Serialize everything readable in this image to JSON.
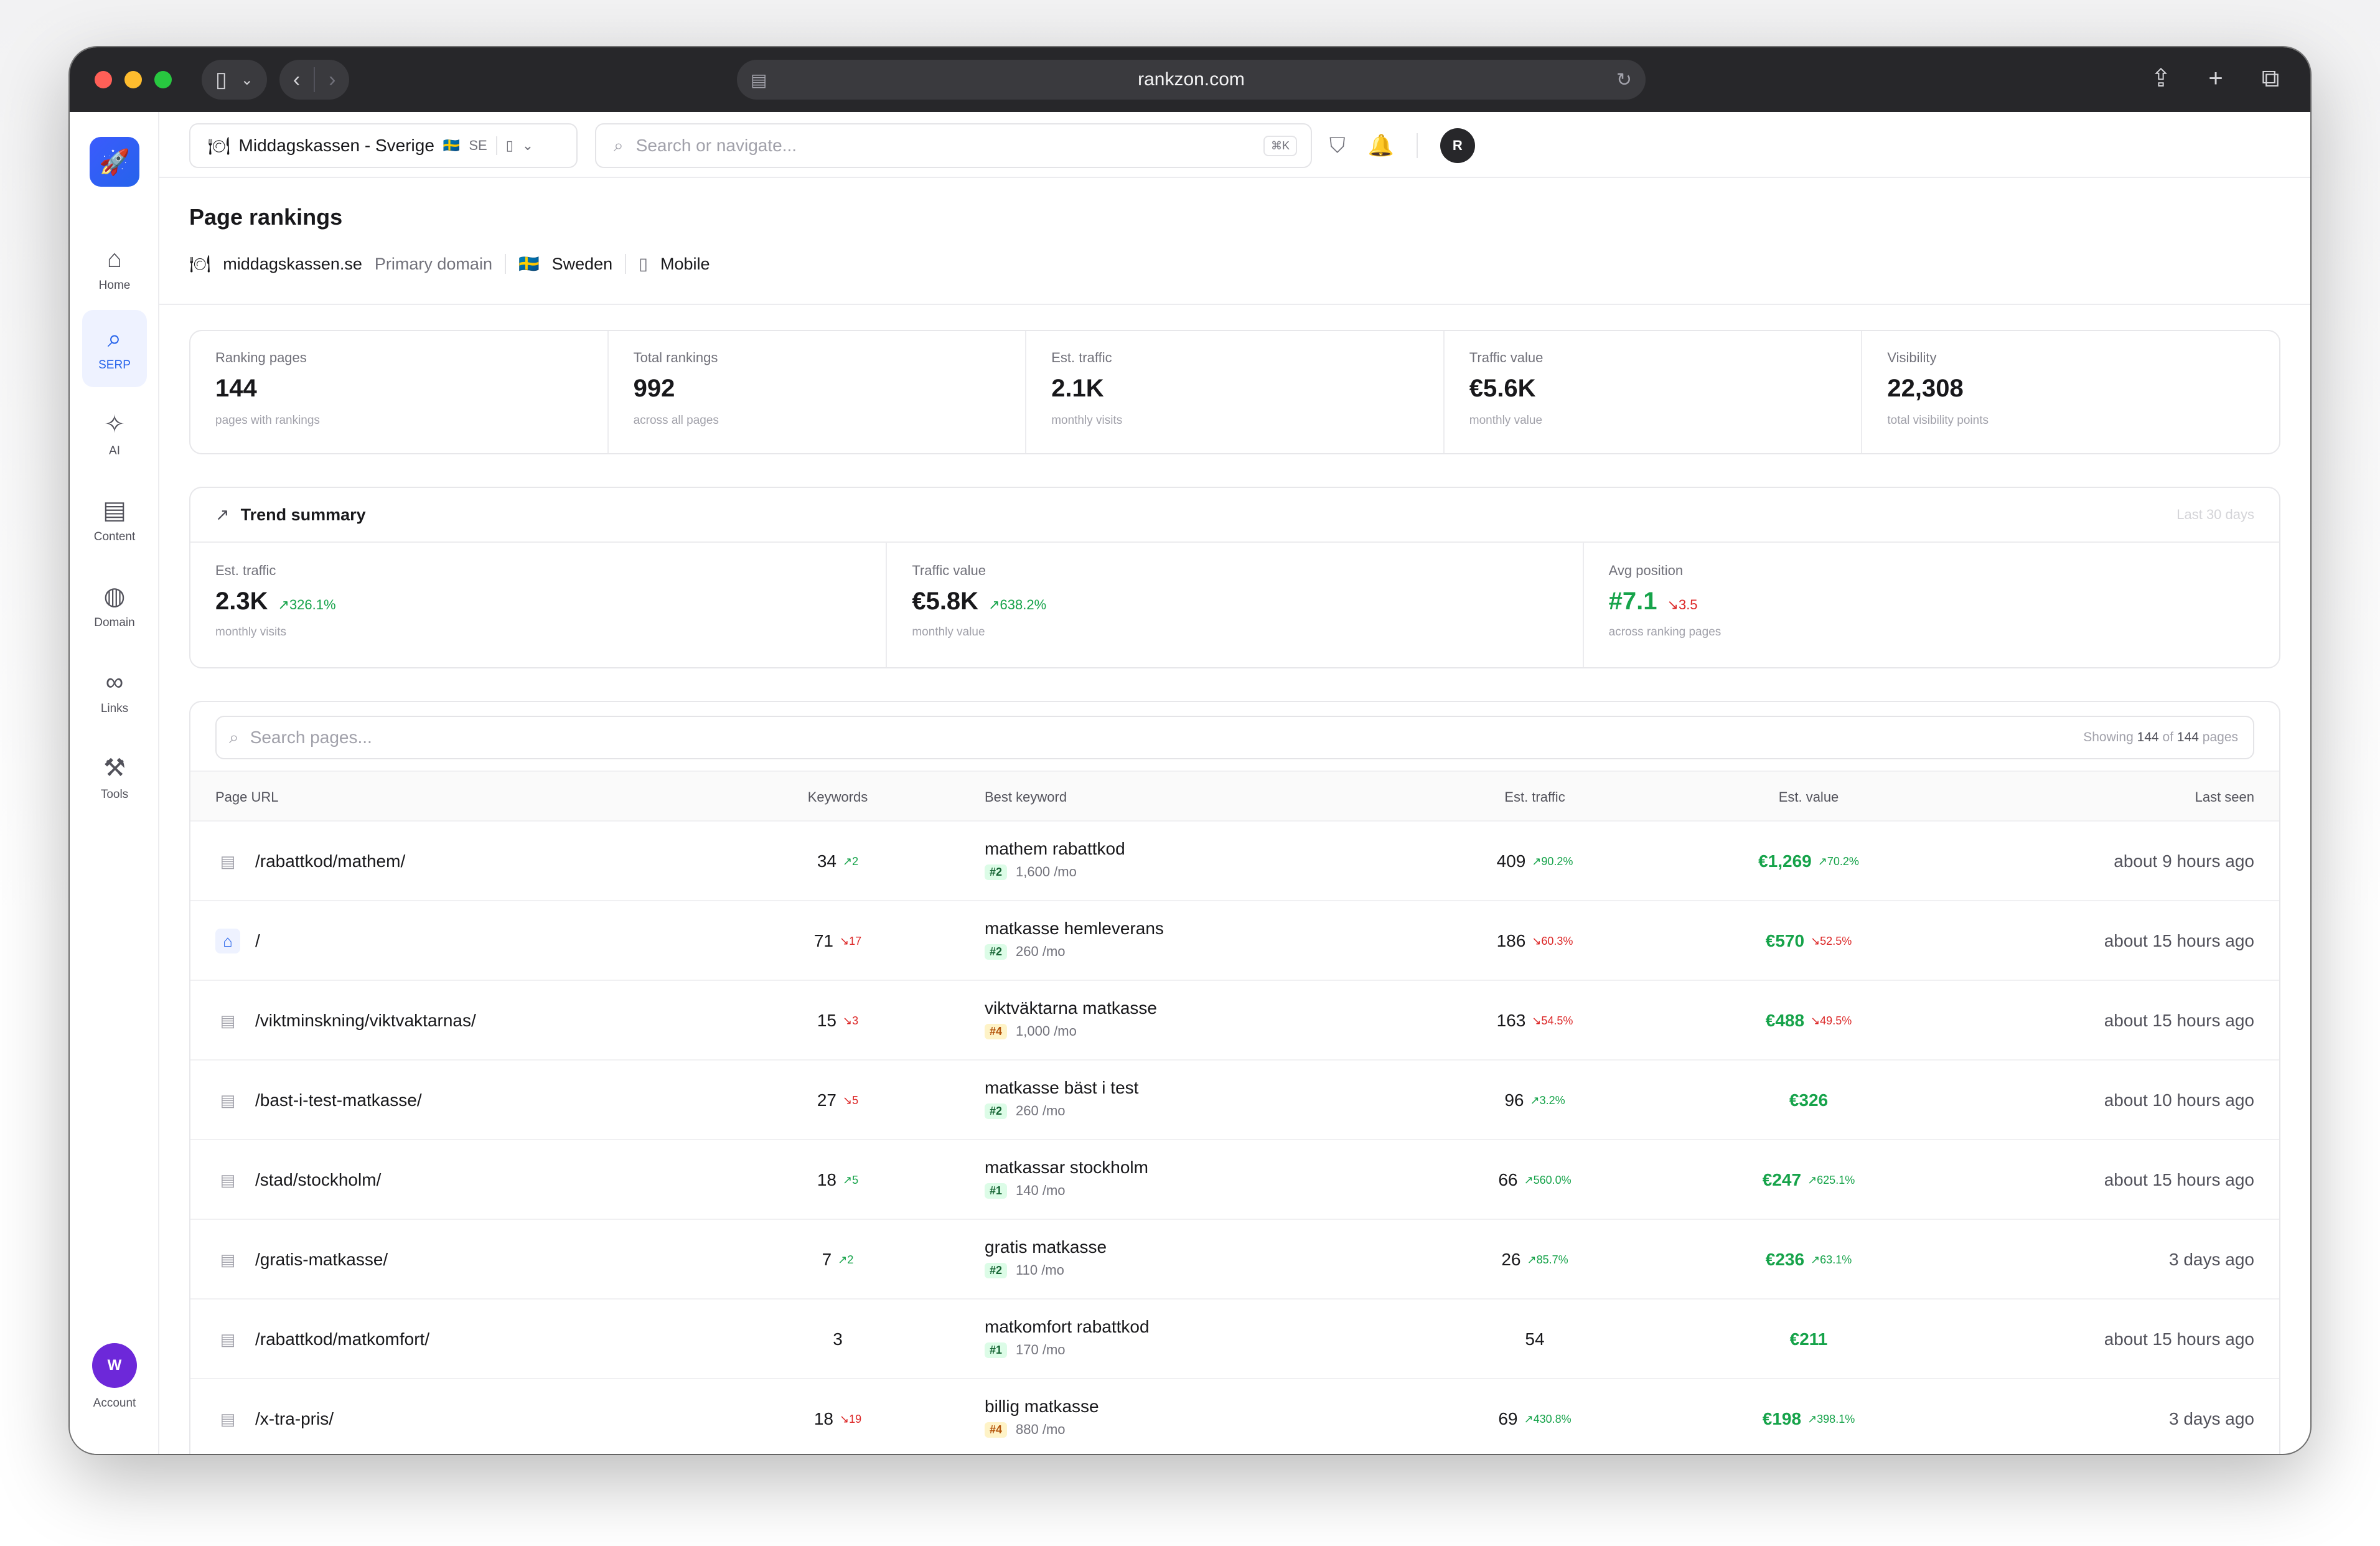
{
  "browser": {
    "url": "rankzon.com"
  },
  "sidebar": {
    "items": [
      {
        "label": "Home",
        "icon": "home-icon"
      },
      {
        "label": "SERP",
        "icon": "search-icon"
      },
      {
        "label": "AI",
        "icon": "sparkles-icon"
      },
      {
        "label": "Content",
        "icon": "document-icon"
      },
      {
        "label": "Domain",
        "icon": "globe-icon"
      },
      {
        "label": "Links",
        "icon": "link-icon"
      },
      {
        "label": "Tools",
        "icon": "wrench-icon"
      }
    ],
    "account": {
      "initial": "W",
      "label": "Account"
    }
  },
  "topbar": {
    "project_name": "Middagskassen - Sverige",
    "project_country": "SE",
    "search_placeholder": "Search or navigate...",
    "shortcut": "⌘K",
    "user_initial": "R"
  },
  "header": {
    "title": "Page rankings",
    "domain": "middagskassen.se",
    "domain_tag": "Primary domain",
    "country": "Sweden",
    "device": "Mobile"
  },
  "stats": [
    {
      "label": "Ranking pages",
      "value": "144",
      "sub": "pages with rankings"
    },
    {
      "label": "Total rankings",
      "value": "992",
      "sub": "across all pages"
    },
    {
      "label": "Est. traffic",
      "value": "2.1K",
      "sub": "monthly visits"
    },
    {
      "label": "Traffic value",
      "value": "€5.6K",
      "sub": "monthly value"
    },
    {
      "label": "Visibility",
      "value": "22,308",
      "sub": "total visibility points"
    }
  ],
  "trend": {
    "title": "Trend summary",
    "period": "Last 30 days",
    "cells": [
      {
        "label": "Est. traffic",
        "value": "2.3K",
        "change": "326.1%",
        "sub": "monthly visits"
      },
      {
        "label": "Traffic value",
        "value": "€5.8K",
        "change": "638.2%",
        "sub": "monthly value"
      },
      {
        "label": "Avg position",
        "value": "#7.1",
        "change": "3.5",
        "sub": "across ranking pages"
      }
    ]
  },
  "table": {
    "search_placeholder": "Search pages...",
    "showing_prefix": "Showing",
    "showing_count": "144",
    "showing_of": "of",
    "showing_total": "144",
    "showing_suffix": "pages",
    "columns": [
      "Page URL",
      "Keywords",
      "Best keyword",
      "Est. traffic",
      "Est. value",
      "Last seen"
    ],
    "rows": [
      {
        "url": "/rabattkod/mathem/",
        "keywords": "34",
        "kw_change": "2",
        "best": "mathem rabattkod",
        "pos": "#2",
        "volume": "1,600 /mo",
        "traffic": "409",
        "traffic_change": "90.2%",
        "value": "€1,269",
        "value_change": "70.2%",
        "seen": "about 9 hours ago"
      },
      {
        "url": "/",
        "keywords": "71",
        "kw_change": "17",
        "best": "matkasse hemleverans",
        "pos": "#2",
        "volume": "260 /mo",
        "traffic": "186",
        "traffic_change": "60.3%",
        "value": "€570",
        "value_change": "52.5%",
        "seen": "about 15 hours ago"
      },
      {
        "url": "/viktminskning/viktvaktarnas/",
        "keywords": "15",
        "kw_change": "3",
        "best": "viktväktarna matkasse",
        "pos": "#4",
        "volume": "1,000 /mo",
        "traffic": "163",
        "traffic_change": "54.5%",
        "value": "€488",
        "value_change": "49.5%",
        "seen": "about 15 hours ago"
      },
      {
        "url": "/bast-i-test-matkasse/",
        "keywords": "27",
        "kw_change": "5",
        "best": "matkasse bäst i test",
        "pos": "#2",
        "volume": "260 /mo",
        "traffic": "96",
        "traffic_change": "3.2%",
        "value": "€326",
        "value_change": "",
        "seen": "about 10 hours ago"
      },
      {
        "url": "/stad/stockholm/",
        "keywords": "18",
        "kw_change": "5",
        "best": "matkassar stockholm",
        "pos": "#1",
        "volume": "140 /mo",
        "traffic": "66",
        "traffic_change": "560.0%",
        "value": "€247",
        "value_change": "625.1%",
        "seen": "about 15 hours ago"
      },
      {
        "url": "/gratis-matkasse/",
        "keywords": "7",
        "kw_change": "2",
        "best": "gratis matkasse",
        "pos": "#2",
        "volume": "110 /mo",
        "traffic": "26",
        "traffic_change": "85.7%",
        "value": "€236",
        "value_change": "63.1%",
        "seen": "3 days ago"
      },
      {
        "url": "/rabattkod/matkomfort/",
        "keywords": "3",
        "kw_change": "",
        "best": "matkomfort rabattkod",
        "pos": "#1",
        "volume": "170 /mo",
        "traffic": "54",
        "traffic_change": "",
        "value": "€211",
        "value_change": "",
        "seen": "about 15 hours ago"
      },
      {
        "url": "/x-tra-pris/",
        "keywords": "18",
        "kw_change": "19",
        "best": "billig matkasse",
        "pos": "#4",
        "volume": "880 /mo",
        "traffic": "69",
        "traffic_change": "430.8%",
        "value": "€198",
        "value_change": "398.1%",
        "seen": "3 days ago"
      }
    ]
  },
  "colors": {
    "accent": "#2563eb",
    "positive": "#16a34a",
    "negative": "#dc2626"
  }
}
